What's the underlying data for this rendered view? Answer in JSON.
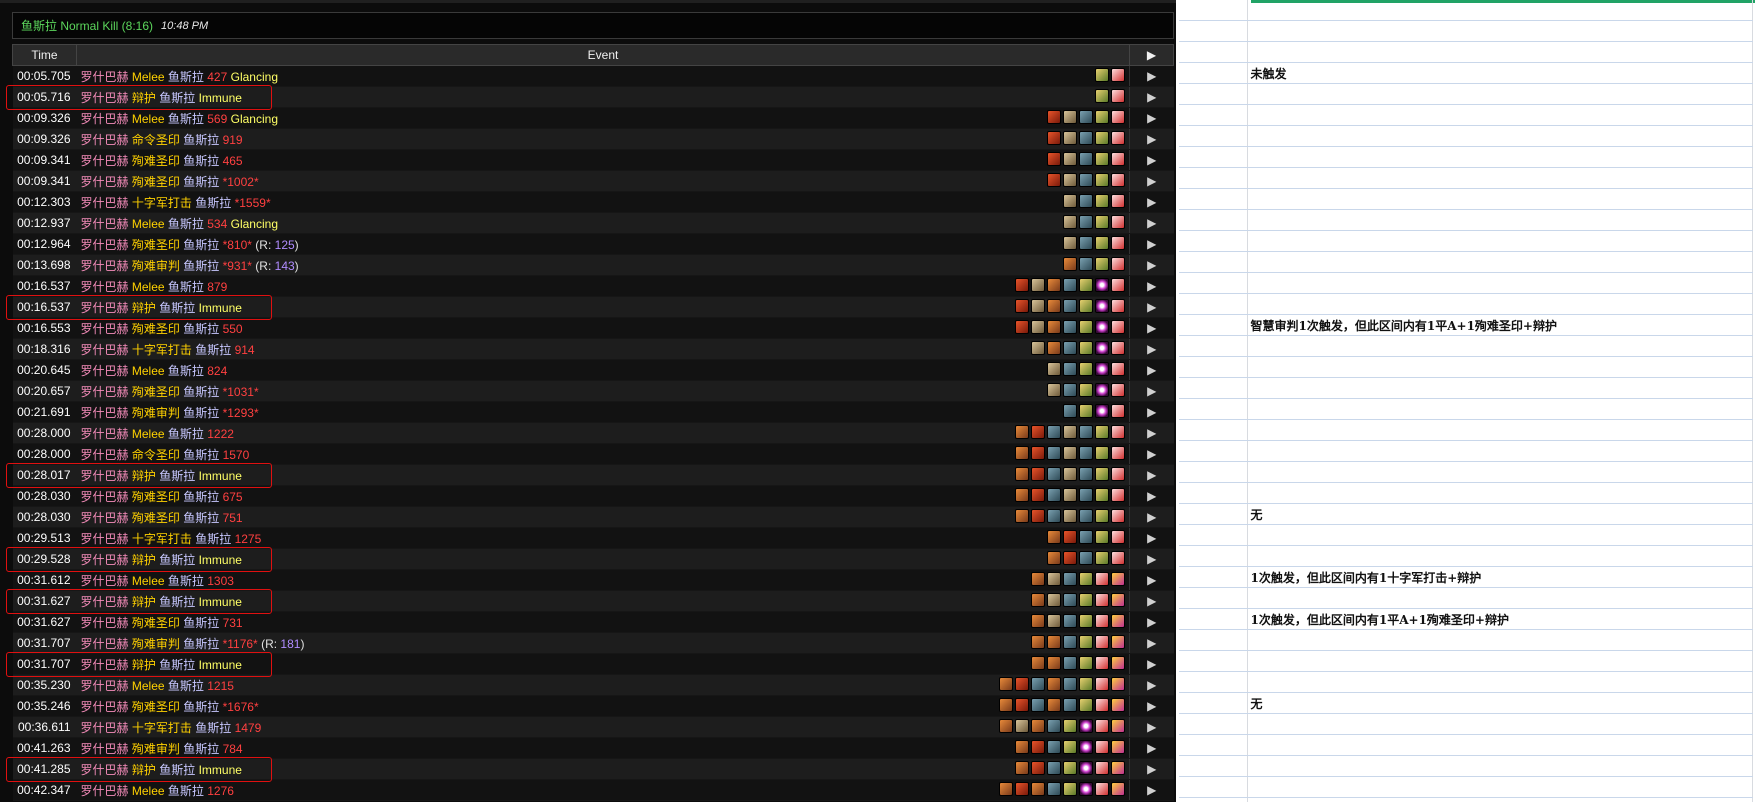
{
  "header": {
    "title": "鱼斯拉 Normal Kill (8:16)",
    "time": "10:48 PM"
  },
  "columns": {
    "time": "Time",
    "event": "Event",
    "arrow": "▶"
  },
  "icons": {
    "seal": "seal-of-command-icon",
    "might": "blessing-of-might-icon",
    "wis": "blessing-of-wisdom-icon",
    "kings": "blessing-of-kings-icon",
    "aura": "retribution-aura-icon",
    "eye": "arcane-eye-icon",
    "fury": "righteous-fury-icon",
    "gold": "golden-buff-icon"
  },
  "rows": [
    {
      "time": "00:05.705",
      "source": "罗什巴赫",
      "ability": "Melee",
      "target": "鱼斯拉",
      "amount": "427",
      "extra": "Glancing",
      "crit": false,
      "buffs": [
        "kings",
        "aura"
      ]
    },
    {
      "time": "00:05.716",
      "source": "罗什巴赫",
      "ability": "辩护",
      "target": "鱼斯拉",
      "amount": "",
      "extra": "Immune",
      "crit": false,
      "buffs": [
        "kings",
        "aura"
      ],
      "highlight": true
    },
    {
      "time": "00:09.326",
      "source": "罗什巴赫",
      "ability": "Melee",
      "target": "鱼斯拉",
      "amount": "569",
      "extra": "Glancing",
      "crit": false,
      "buffs": [
        "seal",
        "might",
        "wis",
        "kings",
        "aura"
      ]
    },
    {
      "time": "00:09.326",
      "source": "罗什巴赫",
      "ability": "命令圣印",
      "target": "鱼斯拉",
      "amount": "919",
      "extra": "",
      "crit": false,
      "buffs": [
        "seal",
        "might",
        "wis",
        "kings",
        "aura"
      ]
    },
    {
      "time": "00:09.341",
      "source": "罗什巴赫",
      "ability": "殉难圣印",
      "target": "鱼斯拉",
      "amount": "465",
      "extra": "",
      "crit": false,
      "buffs": [
        "seal",
        "might",
        "wis",
        "kings",
        "aura"
      ]
    },
    {
      "time": "00:09.341",
      "source": "罗什巴赫",
      "ability": "殉难圣印",
      "target": "鱼斯拉",
      "amount": "*1002*",
      "extra": "",
      "crit": true,
      "buffs": [
        "seal",
        "might",
        "wis",
        "kings",
        "aura"
      ]
    },
    {
      "time": "00:12.303",
      "source": "罗什巴赫",
      "ability": "十字军打击",
      "target": "鱼斯拉",
      "amount": "*1559*",
      "extra": "",
      "crit": true,
      "buffs": [
        "might",
        "wis",
        "kings",
        "aura"
      ]
    },
    {
      "time": "00:12.937",
      "source": "罗什巴赫",
      "ability": "Melee",
      "target": "鱼斯拉",
      "amount": "534",
      "extra": "Glancing",
      "crit": false,
      "buffs": [
        "might",
        "wis",
        "kings",
        "aura"
      ]
    },
    {
      "time": "00:12.964",
      "source": "罗什巴赫",
      "ability": "殉难圣印",
      "target": "鱼斯拉",
      "amount": "*810*",
      "extra": "",
      "resist": "125",
      "crit": true,
      "buffs": [
        "might",
        "wis",
        "kings",
        "aura"
      ]
    },
    {
      "time": "00:13.698",
      "source": "罗什巴赫",
      "ability": "殉难审判",
      "target": "鱼斯拉",
      "amount": "*931*",
      "extra": "",
      "resist": "143",
      "crit": true,
      "buffs": [
        "fury",
        "wis",
        "kings",
        "aura"
      ]
    },
    {
      "time": "00:16.537",
      "source": "罗什巴赫",
      "ability": "Melee",
      "target": "鱼斯拉",
      "amount": "879",
      "extra": "",
      "crit": false,
      "buffs": [
        "seal",
        "might",
        "fury",
        "wis",
        "kings",
        "eye",
        "aura"
      ]
    },
    {
      "time": "00:16.537",
      "source": "罗什巴赫",
      "ability": "辩护",
      "target": "鱼斯拉",
      "amount": "",
      "extra": "Immune",
      "crit": false,
      "buffs": [
        "seal",
        "might",
        "fury",
        "wis",
        "kings",
        "eye",
        "aura"
      ],
      "highlight": true
    },
    {
      "time": "00:16.553",
      "source": "罗什巴赫",
      "ability": "殉难圣印",
      "target": "鱼斯拉",
      "amount": "550",
      "extra": "",
      "crit": false,
      "buffs": [
        "seal",
        "might",
        "fury",
        "wis",
        "kings",
        "eye",
        "aura"
      ]
    },
    {
      "time": "00:18.316",
      "source": "罗什巴赫",
      "ability": "十字军打击",
      "target": "鱼斯拉",
      "amount": "914",
      "extra": "",
      "crit": false,
      "buffs": [
        "might",
        "fury",
        "wis",
        "kings",
        "eye",
        "aura"
      ]
    },
    {
      "time": "00:20.645",
      "source": "罗什巴赫",
      "ability": "Melee",
      "target": "鱼斯拉",
      "amount": "824",
      "extra": "",
      "crit": false,
      "buffs": [
        "might",
        "wis",
        "kings",
        "eye",
        "aura"
      ]
    },
    {
      "time": "00:20.657",
      "source": "罗什巴赫",
      "ability": "殉难圣印",
      "target": "鱼斯拉",
      "amount": "*1031*",
      "extra": "",
      "crit": true,
      "buffs": [
        "might",
        "wis",
        "kings",
        "eye",
        "aura"
      ]
    },
    {
      "time": "00:21.691",
      "source": "罗什巴赫",
      "ability": "殉难审判",
      "target": "鱼斯拉",
      "amount": "*1293*",
      "extra": "",
      "crit": true,
      "buffs": [
        "wis",
        "kings",
        "eye",
        "aura"
      ]
    },
    {
      "time": "00:28.000",
      "source": "罗什巴赫",
      "ability": "Melee",
      "target": "鱼斯拉",
      "amount": "1222",
      "extra": "",
      "crit": false,
      "buffs": [
        "fury",
        "seal",
        "wis",
        "might",
        "wis",
        "kings",
        "aura"
      ]
    },
    {
      "time": "00:28.000",
      "source": "罗什巴赫",
      "ability": "命令圣印",
      "target": "鱼斯拉",
      "amount": "1570",
      "extra": "",
      "crit": false,
      "buffs": [
        "fury",
        "seal",
        "wis",
        "might",
        "wis",
        "kings",
        "aura"
      ]
    },
    {
      "time": "00:28.017",
      "source": "罗什巴赫",
      "ability": "辩护",
      "target": "鱼斯拉",
      "amount": "",
      "extra": "Immune",
      "crit": false,
      "buffs": [
        "fury",
        "seal",
        "wis",
        "might",
        "wis",
        "kings",
        "aura"
      ],
      "highlight": true
    },
    {
      "time": "00:28.030",
      "source": "罗什巴赫",
      "ability": "殉难圣印",
      "target": "鱼斯拉",
      "amount": "675",
      "extra": "",
      "crit": false,
      "buffs": [
        "fury",
        "seal",
        "wis",
        "might",
        "wis",
        "kings",
        "aura"
      ]
    },
    {
      "time": "00:28.030",
      "source": "罗什巴赫",
      "ability": "殉难圣印",
      "target": "鱼斯拉",
      "amount": "751",
      "extra": "",
      "crit": false,
      "buffs": [
        "fury",
        "seal",
        "wis",
        "might",
        "wis",
        "kings",
        "aura"
      ]
    },
    {
      "time": "00:29.513",
      "source": "罗什巴赫",
      "ability": "十字军打击",
      "target": "鱼斯拉",
      "amount": "1275",
      "extra": "",
      "crit": false,
      "buffs": [
        "fury",
        "seal",
        "wis",
        "kings",
        "aura"
      ]
    },
    {
      "time": "00:29.528",
      "source": "罗什巴赫",
      "ability": "辩护",
      "target": "鱼斯拉",
      "amount": "",
      "extra": "Immune",
      "crit": false,
      "buffs": [
        "fury",
        "seal",
        "wis",
        "kings",
        "aura"
      ],
      "highlight": true
    },
    {
      "time": "00:31.612",
      "source": "罗什巴赫",
      "ability": "Melee",
      "target": "鱼斯拉",
      "amount": "1303",
      "extra": "",
      "crit": false,
      "buffs": [
        "fury",
        "might",
        "wis",
        "kings",
        "aura",
        "gold"
      ]
    },
    {
      "time": "00:31.627",
      "source": "罗什巴赫",
      "ability": "辩护",
      "target": "鱼斯拉",
      "amount": "",
      "extra": "Immune",
      "crit": false,
      "buffs": [
        "fury",
        "might",
        "wis",
        "kings",
        "aura",
        "gold"
      ],
      "highlight": true
    },
    {
      "time": "00:31.627",
      "source": "罗什巴赫",
      "ability": "殉难圣印",
      "target": "鱼斯拉",
      "amount": "731",
      "extra": "",
      "crit": false,
      "buffs": [
        "fury",
        "might",
        "wis",
        "kings",
        "aura",
        "gold"
      ]
    },
    {
      "time": "00:31.707",
      "source": "罗什巴赫",
      "ability": "殉难审判",
      "target": "鱼斯拉",
      "amount": "*1176*",
      "extra": "",
      "resist": "181",
      "crit": true,
      "buffs": [
        "fury",
        "fury",
        "wis",
        "kings",
        "aura",
        "gold"
      ]
    },
    {
      "time": "00:31.707",
      "source": "罗什巴赫",
      "ability": "辩护",
      "target": "鱼斯拉",
      "amount": "",
      "extra": "Immune",
      "crit": false,
      "buffs": [
        "fury",
        "fury",
        "wis",
        "kings",
        "aura",
        "gold"
      ],
      "highlight": true
    },
    {
      "time": "00:35.230",
      "source": "罗什巴赫",
      "ability": "Melee",
      "target": "鱼斯拉",
      "amount": "1215",
      "extra": "",
      "crit": false,
      "buffs": [
        "fury",
        "seal",
        "wis",
        "fury",
        "wis",
        "kings",
        "aura",
        "gold"
      ]
    },
    {
      "time": "00:35.246",
      "source": "罗什巴赫",
      "ability": "殉难圣印",
      "target": "鱼斯拉",
      "amount": "*1676*",
      "extra": "",
      "crit": true,
      "buffs": [
        "fury",
        "seal",
        "wis",
        "fury",
        "wis",
        "kings",
        "aura",
        "gold"
      ]
    },
    {
      "time": "00:36.611",
      "source": "罗什巴赫",
      "ability": "十字军打击",
      "target": "鱼斯拉",
      "amount": "1479",
      "extra": "",
      "crit": false,
      "buffs": [
        "fury",
        "might",
        "fury",
        "wis",
        "kings",
        "eye",
        "aura",
        "gold"
      ]
    },
    {
      "time": "00:41.263",
      "source": "罗什巴赫",
      "ability": "殉难审判",
      "target": "鱼斯拉",
      "amount": "784",
      "extra": "",
      "crit": false,
      "buffs": [
        "fury",
        "seal",
        "wis",
        "kings",
        "eye",
        "aura",
        "gold"
      ]
    },
    {
      "time": "00:41.285",
      "source": "罗什巴赫",
      "ability": "辩护",
      "target": "鱼斯拉",
      "amount": "",
      "extra": "Immune",
      "crit": false,
      "buffs": [
        "fury",
        "seal",
        "wis",
        "kings",
        "eye",
        "aura",
        "gold"
      ],
      "highlight": true
    },
    {
      "time": "00:42.347",
      "source": "罗什巴赫",
      "ability": "Melee",
      "target": "鱼斯拉",
      "amount": "1276",
      "extra": "",
      "crit": false,
      "buffs": [
        "fury",
        "seal",
        "fury",
        "wis",
        "kings",
        "eye",
        "aura",
        "gold"
      ]
    }
  ],
  "resist_prefix": "(R: ",
  "resist_suffix": ")",
  "sheet_notes": [
    {
      "row": 3,
      "text": "未触发"
    },
    {
      "row": 15,
      "text": "智慧审判1次触发，但此区间内有1平A+1殉难圣印+辩护"
    },
    {
      "row": 24,
      "text": "无"
    },
    {
      "row": 27,
      "text": "1次触发，但此区间内有1十字军打击+辩护"
    },
    {
      "row": 29,
      "text": "1次触发，但此区间内有1平A+1殉难圣印+辩护"
    },
    {
      "row": 33,
      "text": "无"
    }
  ]
}
